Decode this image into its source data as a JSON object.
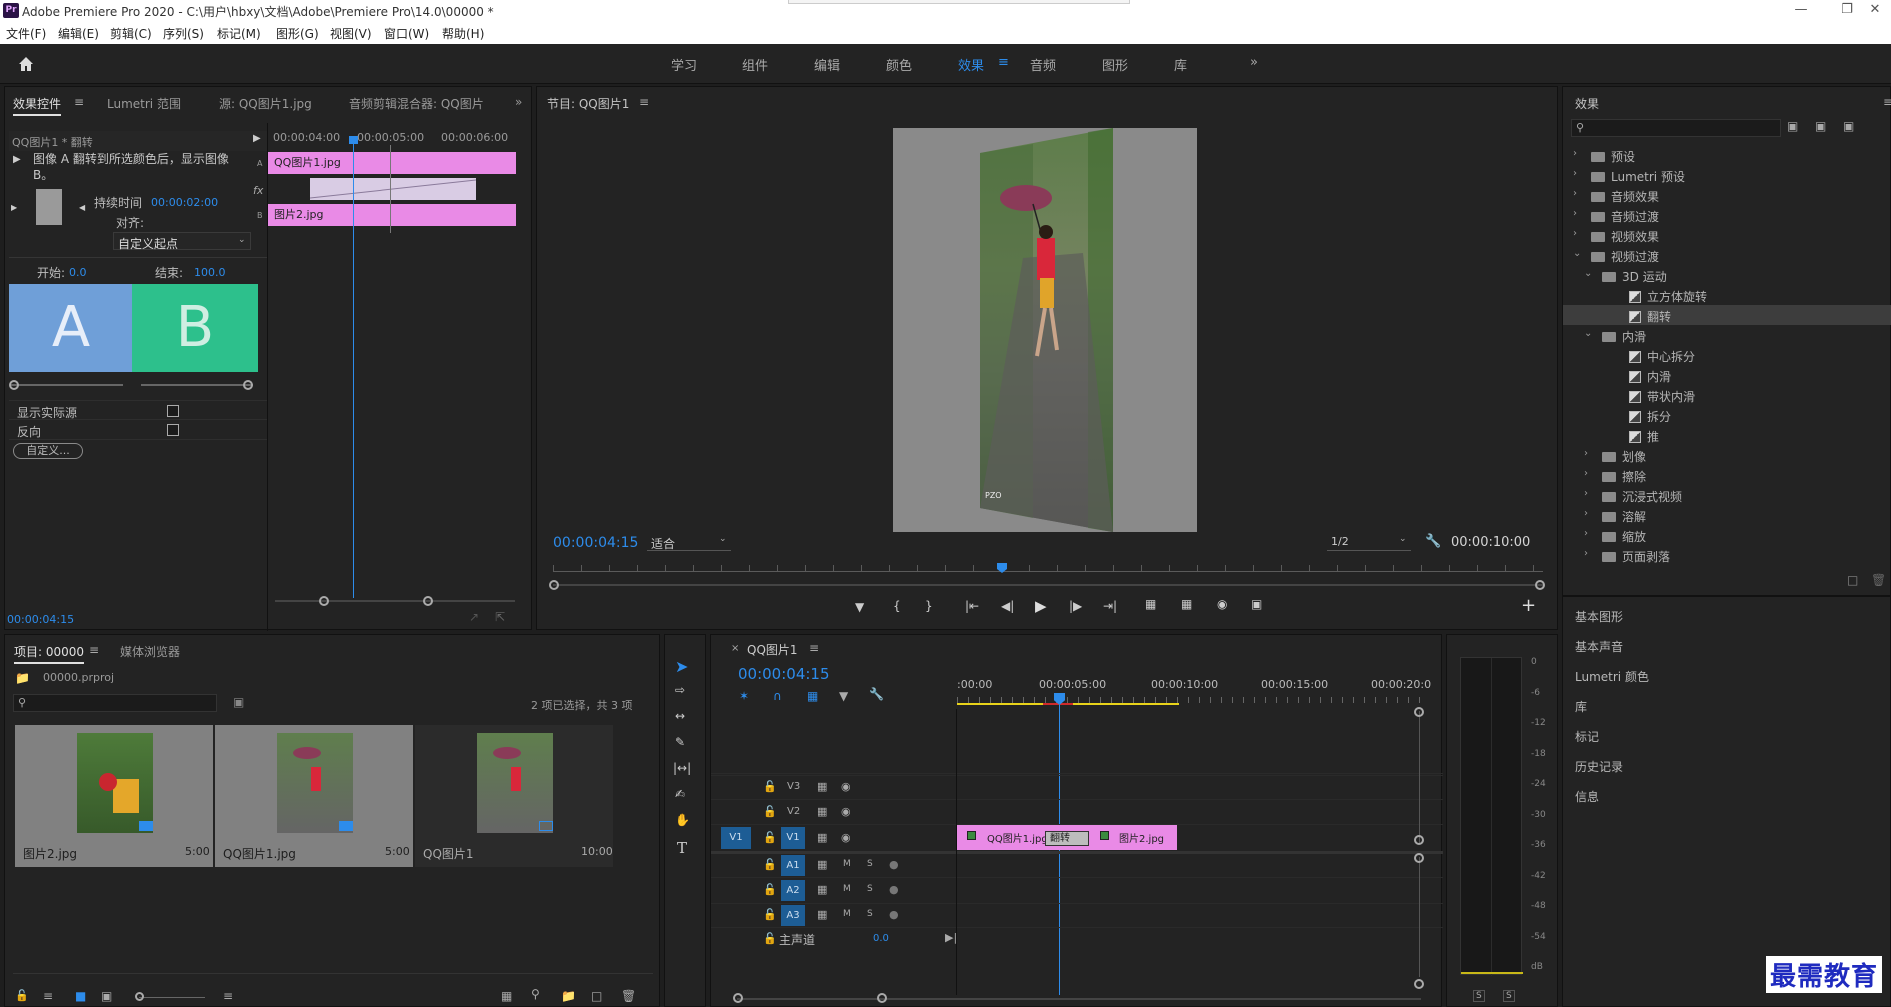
{
  "app": {
    "title": "Adobe Premiere Pro 2020 - C:\\用户\\hbxy\\文档\\Adobe\\Premiere Pro\\14.0\\00000 *",
    "logo": "Pr"
  },
  "menu": [
    "文件(F)",
    "编辑(E)",
    "剪辑(C)",
    "序列(S)",
    "标记(M)",
    "图形(G)",
    "视图(V)",
    "窗口(W)",
    "帮助(H)"
  ],
  "workspaces": [
    "学习",
    "组件",
    "编辑",
    "颜色",
    "效果",
    "音频",
    "图形",
    "库"
  ],
  "workspace_active": "效果",
  "effect_controls": {
    "tabs": [
      "效果控件",
      "Lumetri 范围",
      "源: QQ图片1.jpg",
      "音频剪辑混合器: QQ图片"
    ],
    "clip_name": "QQ图片1 * 翻转",
    "description": "图像 A 翻转到所选颜色后，显示图像 B。",
    "duration_label": "持续时间",
    "duration_value": "00:00:02:00",
    "align_label": "对齐:",
    "align_value": "自定义起点",
    "start_label": "开始:",
    "start_value": "0.0",
    "end_label": "结束:",
    "end_value": "100.0",
    "preview_a": "A",
    "preview_b": "B",
    "show_source_label": "显示实际源",
    "reverse_label": "反向",
    "custom_button": "自定义...",
    "timecode": "00:00:04:15",
    "mini_timeline": {
      "ruler": [
        "00:00:04:00",
        "00:00:05:00",
        "00:00:06:00"
      ],
      "clip_a": "QQ图片1.jpg",
      "clip_b": "图片2.jpg",
      "track_a": "A",
      "track_b": "B",
      "fx": "fx"
    }
  },
  "program_monitor": {
    "title": "节目: QQ图片1",
    "timecode": "00:00:04:15",
    "fit_value": "适合",
    "resolution": "1/2",
    "duration": "00:00:10:00"
  },
  "project": {
    "tabs": [
      "项目: 00000",
      "媒体浏览器"
    ],
    "file": "00000.prproj",
    "selection_info": "2 项已选择，共 3 项",
    "items": [
      {
        "name": "图片2.jpg",
        "duration": "5:00"
      },
      {
        "name": "QQ图片1.jpg",
        "duration": "5:00"
      },
      {
        "name": "QQ图片1",
        "duration": "10:00"
      }
    ]
  },
  "timeline": {
    "title": "QQ图片1",
    "timecode": "00:00:04:15",
    "ruler": [
      ":00:00",
      "00:00:05:00",
      "00:00:10:00",
      "00:00:15:00",
      "00:00:20:0"
    ],
    "video_tracks": [
      "V3",
      "V2",
      "V1"
    ],
    "audio_tracks": [
      "A1",
      "A2",
      "A3"
    ],
    "source_patch_v": "V1",
    "master_label": "主声道",
    "master_value": "0.0",
    "clip_1": "QQ图片1.jpg",
    "transition": "翻转",
    "clip_2": "图片2.jpg",
    "m": "M",
    "s": "S"
  },
  "effects_panel": {
    "title": "效果",
    "tree": [
      {
        "label": "预设",
        "level": 0,
        "type": "folder-special"
      },
      {
        "label": "Lumetri 预设",
        "level": 0,
        "type": "folder-special"
      },
      {
        "label": "音频效果",
        "level": 0,
        "type": "folder"
      },
      {
        "label": "音频过渡",
        "level": 0,
        "type": "folder"
      },
      {
        "label": "视频效果",
        "level": 0,
        "type": "folder"
      },
      {
        "label": "视频过渡",
        "level": 0,
        "type": "folder",
        "open": true
      },
      {
        "label": "3D 运动",
        "level": 1,
        "type": "folder",
        "open": true
      },
      {
        "label": "立方体旋转",
        "level": 2,
        "type": "fx"
      },
      {
        "label": "翻转",
        "level": 2,
        "type": "fx",
        "selected": true
      },
      {
        "label": "内滑",
        "level": 1,
        "type": "folder",
        "open": true
      },
      {
        "label": "中心拆分",
        "level": 2,
        "type": "fx"
      },
      {
        "label": "内滑",
        "level": 2,
        "type": "fx"
      },
      {
        "label": "带状内滑",
        "level": 2,
        "type": "fx"
      },
      {
        "label": "拆分",
        "level": 2,
        "type": "fx"
      },
      {
        "label": "推",
        "level": 2,
        "type": "fx"
      },
      {
        "label": "划像",
        "level": 1,
        "type": "folder"
      },
      {
        "label": "擦除",
        "level": 1,
        "type": "folder"
      },
      {
        "label": "沉浸式视频",
        "level": 1,
        "type": "folder"
      },
      {
        "label": "溶解",
        "level": 1,
        "type": "folder"
      },
      {
        "label": "缩放",
        "level": 1,
        "type": "folder"
      },
      {
        "label": "页面剥落",
        "level": 1,
        "type": "folder"
      }
    ],
    "sections": [
      "基本图形",
      "基本声音",
      "Lumetri 颜色",
      "库",
      "标记",
      "历史记录",
      "信息"
    ]
  },
  "meter": {
    "labels": [
      "0",
      "-6",
      "-12",
      "-18",
      "-24",
      "-30",
      "-36",
      "-42",
      "-48",
      "-54",
      "dB"
    ],
    "solo": [
      "S",
      "S"
    ]
  },
  "watermark": "最需教育",
  "colors": {
    "accent": "#2d8ceb",
    "clip": "#e98ae6",
    "preview_a": "#6f9fd8",
    "preview_b": "#2dc08c"
  }
}
